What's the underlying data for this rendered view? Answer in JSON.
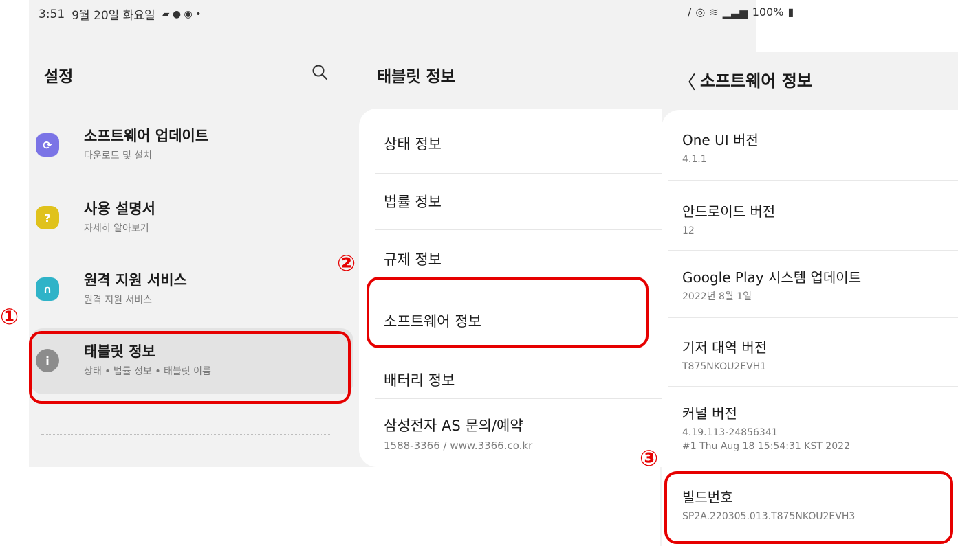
{
  "status_bar": {
    "time": "3:51",
    "date": "9월 20일 화요일",
    "right": "100%"
  },
  "panel_settings": {
    "title": "설정",
    "items": [
      {
        "label": "소프트웨어 업데이트",
        "sub": "다운로드 및 설치",
        "color": "#7b74e6"
      },
      {
        "label": "사용 설명서",
        "sub": "자세히 알아보기",
        "color": "#e0c21c"
      },
      {
        "label": "원격 지원 서비스",
        "sub": "원격 지원 서비스",
        "color": "#2fb3c8"
      },
      {
        "label": "태블릿 정보",
        "sub": "상태 • 법률 정보 • 태블릿 이름",
        "color": "#8c8c8c"
      }
    ]
  },
  "panel_tablet_info": {
    "title": "태블릿 정보",
    "items": [
      {
        "label": "상태 정보"
      },
      {
        "label": "법률 정보"
      },
      {
        "label": "규제 정보"
      },
      {
        "label": "소프트웨어 정보"
      },
      {
        "label": "배터리 정보"
      },
      {
        "label": "삼성전자 AS 문의/예약",
        "sub": "1588-3366 / www.3366.co.kr"
      }
    ]
  },
  "panel_software_info": {
    "title": "소프트웨어 정보",
    "items": [
      {
        "label": "One UI 버전",
        "sub": "4.1.1"
      },
      {
        "label": "안드로이드 버전",
        "sub": "12"
      },
      {
        "label": "Google Play 시스템 업데이트",
        "sub": "2022년 8월 1일"
      },
      {
        "label": "기저 대역 버전",
        "sub": "T875NKOU2EVH1"
      },
      {
        "label": "커널 버전",
        "sub": "4.19.113-24856341",
        "sub2": "#1 Thu Aug 18 15:54:31 KST 2022"
      },
      {
        "label": "빌드번호",
        "sub": "SP2A.220305.013.T875NKOU2EVH3"
      }
    ]
  },
  "annotations": {
    "step1": "①",
    "step2": "②",
    "step3": "③",
    "color": "#e60000"
  }
}
